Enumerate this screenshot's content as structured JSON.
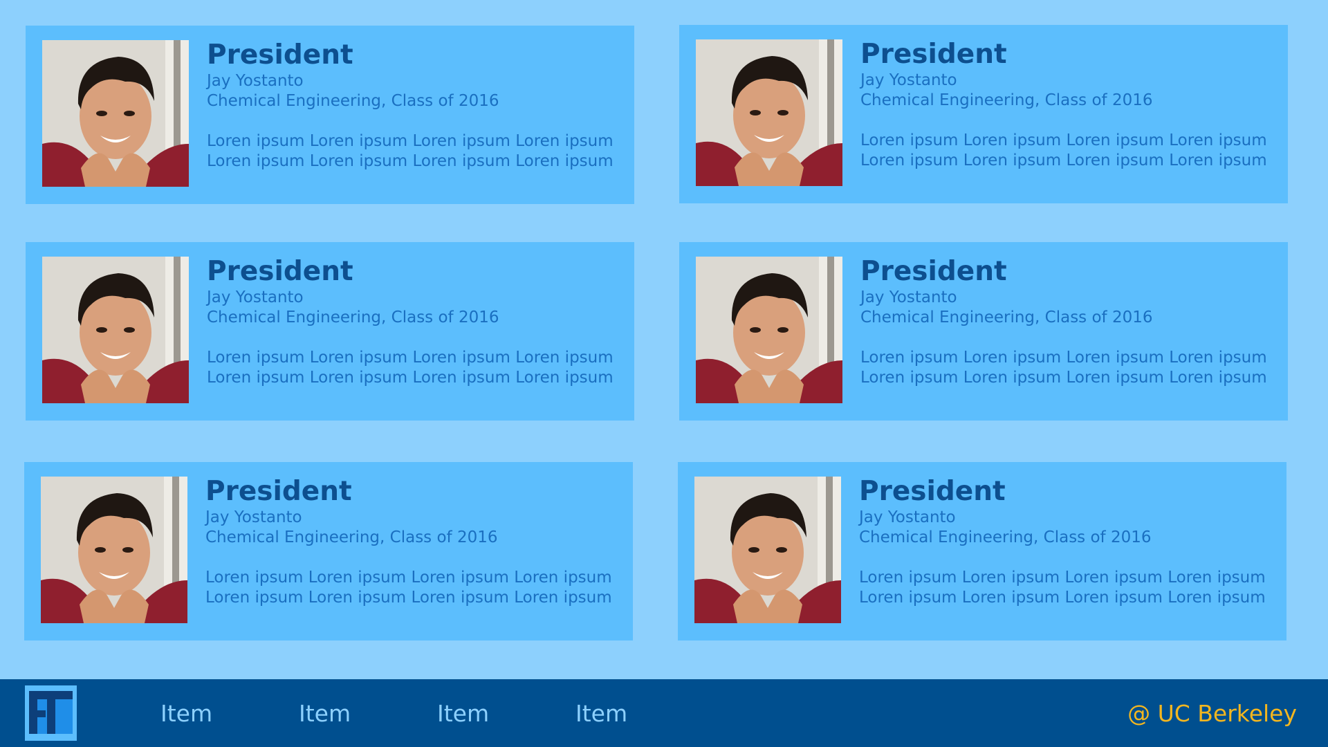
{
  "cards": [
    {
      "role": "President",
      "name": "Jay Yostanto",
      "major": "Chemical Engineering, Class of 2016",
      "desc": "Loren ipsum Loren ipsum Loren ipsum Loren ipsum Loren ipsum Loren ipsum Loren ipsum Loren ipsum"
    },
    {
      "role": "President",
      "name": "Jay Yostanto",
      "major": "Chemical Engineering, Class of 2016",
      "desc": "Loren ipsum Loren ipsum Loren ipsum Loren ipsum Loren ipsum Loren ipsum Loren ipsum Loren ipsum"
    },
    {
      "role": "President",
      "name": "Jay Yostanto",
      "major": "Chemical Engineering, Class of 2016",
      "desc": "Loren ipsum Loren ipsum Loren ipsum Loren ipsum Loren ipsum Loren ipsum Loren ipsum Loren ipsum"
    },
    {
      "role": "President",
      "name": "Jay Yostanto",
      "major": "Chemical Engineering, Class of 2016",
      "desc": "Loren ipsum Loren ipsum Loren ipsum Loren ipsum Loren ipsum Loren ipsum Loren ipsum Loren ipsum"
    },
    {
      "role": "President",
      "name": "Jay Yostanto",
      "major": "Chemical Engineering, Class of 2016",
      "desc": "Loren ipsum Loren ipsum Loren ipsum Loren ipsum Loren ipsum Loren ipsum Loren ipsum Loren ipsum"
    },
    {
      "role": "President",
      "name": "Jay Yostanto",
      "major": "Chemical Engineering, Class of 2016",
      "desc": "Loren ipsum Loren ipsum Loren ipsum Loren ipsum Loren ipsum Loren ipsum Loren ipsum Loren ipsum"
    }
  ],
  "footer": {
    "logo_icon": "ft-logo-icon",
    "nav": [
      "Item",
      "Item",
      "Item",
      "Item"
    ],
    "credit": "@ UC Berkeley"
  },
  "colors": {
    "background": "#8dd0fd",
    "card": "#5cbefd",
    "footer": "#004f8f",
    "title": "#0d4f8f",
    "body_text": "#1a6fc0",
    "nav_text": "#8dd0fd",
    "credit_text": "#f3b61f"
  }
}
